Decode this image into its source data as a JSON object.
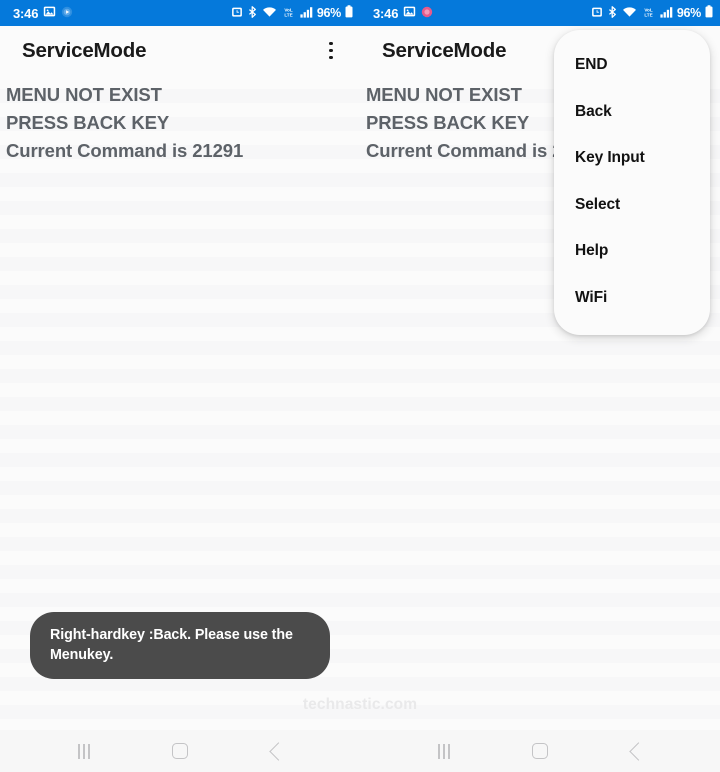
{
  "status_bar": {
    "time": "3:46",
    "battery_percent": "96%",
    "icons": [
      "gallery-icon",
      "media-circle-icon",
      "alarm-icon",
      "bluetooth-icon",
      "wifi-icon",
      "volte-icon",
      "signal-bars-icon",
      "battery-icon"
    ],
    "background_color": "#0579db",
    "foreground_color": "#ffffff"
  },
  "app_bar": {
    "title": "ServiceMode",
    "overflow_label": "More options"
  },
  "screen": {
    "lines": [
      "MENU NOT EXIST",
      "PRESS BACK KEY",
      "Current Command is 21291"
    ],
    "text_color": "#5d6268"
  },
  "toast": {
    "message": "Right-hardkey :Back.   Please use the Menukey.",
    "background_color": "#4b4b4b",
    "text_color": "#ffffff"
  },
  "dropdown": {
    "items": [
      {
        "label": "END"
      },
      {
        "label": "Back"
      },
      {
        "label": "Key Input"
      },
      {
        "label": "Select"
      },
      {
        "label": "Help"
      },
      {
        "label": "WiFi"
      }
    ]
  },
  "watermark": {
    "text": "technastic.com",
    "color": "#e9e9ea"
  },
  "nav_bar": {
    "recents_label": "Recents",
    "home_label": "Home",
    "back_label": "Back"
  }
}
